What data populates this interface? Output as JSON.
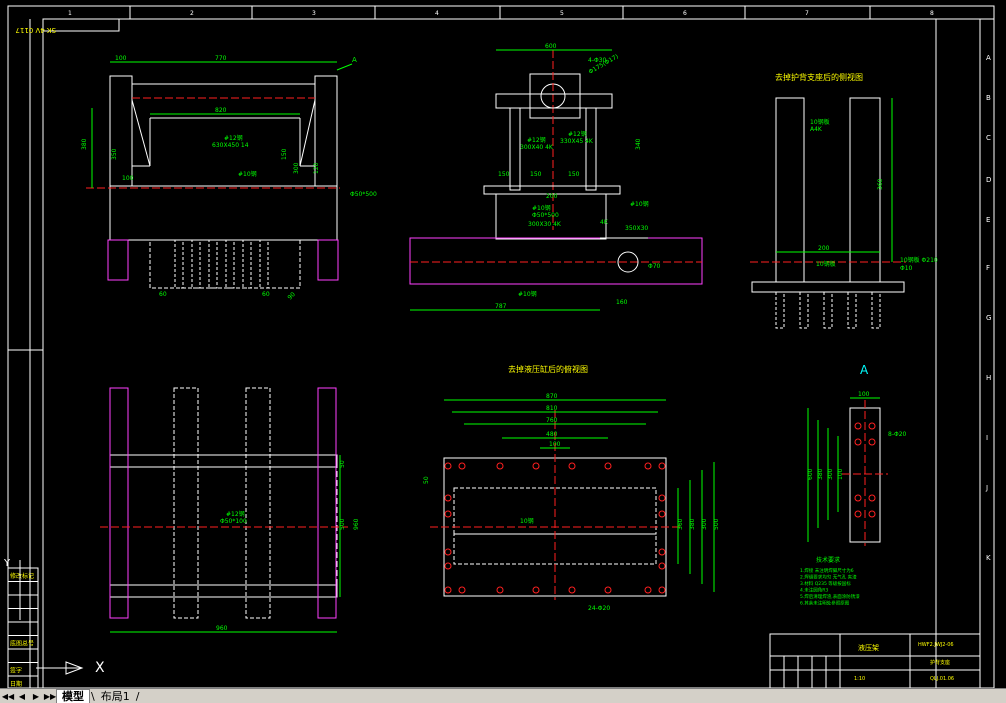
{
  "drawing": {
    "scale_note": "SK 4V 0117",
    "top_zone_numbers": [
      "1",
      "2",
      "3",
      "4",
      "5",
      "6",
      "7",
      "8"
    ],
    "right_zone_letters": [
      "A",
      "B",
      "C",
      "D",
      "E",
      "F",
      "G",
      "H",
      "I",
      "J",
      "K"
    ],
    "views": {
      "front": {
        "dims": [
          "100",
          "770",
          "820",
          "380",
          "350",
          "100",
          "150",
          "300",
          "120",
          "60",
          "60",
          "90",
          "960"
        ],
        "labels": [
          "A",
          "#12钢",
          "630X450 14",
          "#10钢",
          "Φ50*500"
        ]
      },
      "side": {
        "dims": [
          "600",
          "4-Φ30",
          "Φ175(Φ17)",
          "340",
          "150",
          "150",
          "150",
          "200",
          "787",
          "160",
          "Φ70"
        ],
        "labels": [
          "#12钢",
          "300X40 4K",
          "#12钢",
          "330X45 4K",
          "#10钢",
          "Φ50*500",
          "300X30 4K",
          "#10钢",
          "350X30",
          "#10钢",
          "4K"
        ]
      },
      "rear_right": {
        "title": "去掉护背支座后的侧视图",
        "dims": [
          "360",
          "200"
        ],
        "labels": [
          "10钢板",
          "Φ10",
          "A4K",
          "10钢板",
          "10钢板 Φ210"
        ]
      },
      "bottom_left": {
        "dims": [
          "960",
          "50",
          "500",
          "960",
          "90"
        ],
        "labels": [
          "#12钢",
          "Φ50*100"
        ]
      },
      "plan": {
        "title": "去掉液压缸后的俯视图",
        "dims": [
          "870",
          "810",
          "760",
          "480",
          "100",
          "50",
          "500",
          "360",
          "380",
          "300",
          "500"
        ],
        "labels": [
          "24-Φ20",
          "10钢"
        ]
      },
      "detail_a": {
        "title": "A",
        "dims": [
          "100",
          "600",
          "380",
          "300",
          "100"
        ],
        "labels": [
          "8-Φ20"
        ]
      }
    },
    "notes": {
      "title": "技术要求",
      "lines": [
        "1.焊接  未注明焊脚尺寸为6",
        "2.焊缝要求均匀  无气孔  夹渣",
        "3.材料  Q235  等级按国标",
        "4.未注圆角R3",
        "5.焊后清理焊渣,表面涂防锈漆",
        "6.其余未注明处参照原图"
      ]
    },
    "title_block": {
      "title": "液压架",
      "drawing_no": "HWF2.JWJ2-06",
      "part_name": "护背支座",
      "scale": "1:10",
      "sheet": "QLJ.01.06"
    },
    "left_panel": {
      "cells": [
        "修改标记",
        "",
        "",
        "",
        "",
        "底图总号",
        "",
        "签字",
        "日期"
      ]
    },
    "ucs": {
      "x_label": "X",
      "y_label": "Y"
    }
  },
  "tabs": {
    "model_label": "模型",
    "layout1_label": "布局1"
  },
  "colors": {
    "border": "#ffffff",
    "dim": "#00ff00",
    "geometry": "#ffffff",
    "center": "#ff2020",
    "magenta": "#ff40ff",
    "cyan": "#00ffff",
    "yellow": "#ffff00",
    "blue": "#3060ff"
  }
}
